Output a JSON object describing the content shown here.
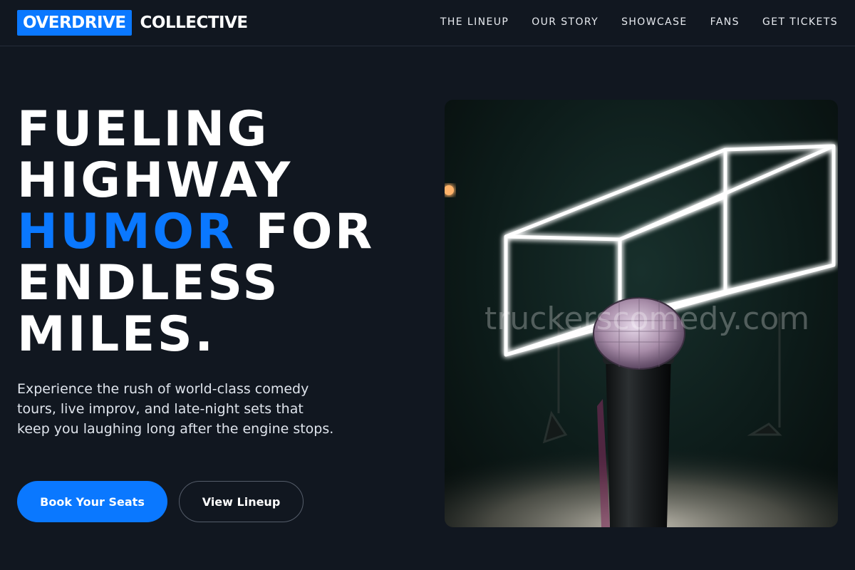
{
  "brand": {
    "mark": "OVERDRIVE",
    "name": "COLLECTIVE"
  },
  "nav": {
    "items": [
      {
        "label": "THE LINEUP"
      },
      {
        "label": "OUR STORY"
      },
      {
        "label": "SHOWCASE"
      },
      {
        "label": "FANS"
      },
      {
        "label": "GET TICKETS"
      }
    ]
  },
  "hero": {
    "title_line1": "FUELING",
    "title_line2": "HIGHWAY",
    "title_accent": "HUMOR",
    "title_line3_rest": " FOR",
    "title_line4": "ENDLESS",
    "title_line5": "MILES.",
    "subtitle": "Experience the rush of world-class comedy tours, live improv, and late-night sets that keep you laughing long after the engine stops.",
    "primary_button": "Book Your Seats",
    "secondary_button": "View Lineup",
    "image_watermark": "truckerscomedy.com"
  },
  "colors": {
    "background": "#111720",
    "accent": "#0a78ff",
    "text": "#ffffff"
  }
}
